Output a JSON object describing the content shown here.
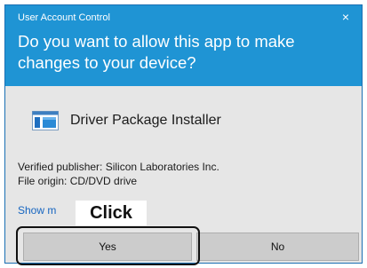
{
  "dialog": {
    "title": "User Account Control",
    "close_icon": "×",
    "question": "Do you want to allow this app to make changes to your device?",
    "app_icon": "installer-icon",
    "app_name": "Driver Package Installer",
    "publisher": "Verified publisher: Silicon Laboratories Inc.",
    "origin": "File origin: CD/DVD drive",
    "show_more": "Show m",
    "yes_label": "Yes",
    "no_label": "No"
  },
  "annotation": {
    "click_label": "Click"
  },
  "colors": {
    "header": "#1f94d4",
    "body": "#e6e6e6",
    "button": "#cccccc",
    "link": "#1565c0"
  }
}
